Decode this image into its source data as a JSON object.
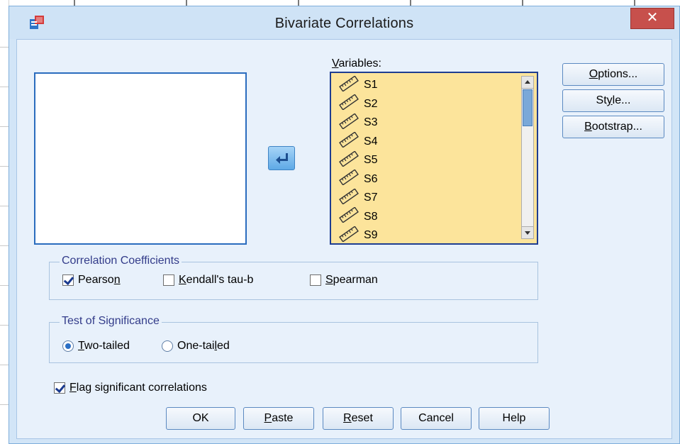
{
  "dialog": {
    "title": "Bivariate Correlations",
    "close_label": "✕"
  },
  "variables": {
    "label_prefix": "",
    "label_accel": "V",
    "label_rest": "ariables:",
    "items": [
      "S1",
      "S2",
      "S3",
      "S4",
      "S5",
      "S6",
      "S7",
      "S8",
      "S9"
    ]
  },
  "side_buttons": {
    "options_accel": "O",
    "options_rest": "ptions...",
    "style_pre": "St",
    "style_accel": "y",
    "style_rest": "le...",
    "bootstrap_accel": "B",
    "bootstrap_rest": "ootstrap..."
  },
  "coefficients": {
    "title": "Correlation Coefficients",
    "pearson_pre": "Pearso",
    "pearson_accel": "n",
    "pearson_checked": true,
    "kendall_accel": "K",
    "kendall_rest": "endall's tau-b",
    "kendall_checked": false,
    "spearman_accel": "S",
    "spearman_rest": "pearman",
    "spearman_checked": false
  },
  "significance": {
    "title": "Test of Significance",
    "two_accel": "T",
    "two_rest": "wo-tailed",
    "two_selected": true,
    "one_pre": "One-tai",
    "one_accel": "l",
    "one_rest": "ed",
    "one_selected": false
  },
  "flag": {
    "accel": "F",
    "rest": "lag significant correlations",
    "checked": true
  },
  "bottom_buttons": {
    "ok": "OK",
    "paste_accel": "P",
    "paste_rest": "aste",
    "reset_accel": "R",
    "reset_rest": "eset",
    "cancel": "Cancel",
    "help": "Help"
  },
  "colors": {
    "list_bg": "#fce49b",
    "accent": "#2a6cbe",
    "close_red": "#c7504c"
  }
}
